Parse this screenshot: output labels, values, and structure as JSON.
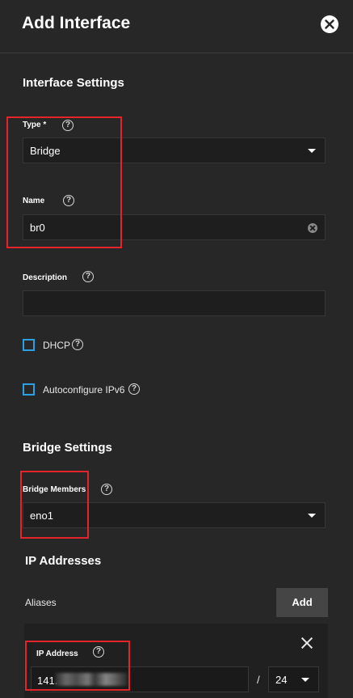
{
  "dialog": {
    "title": "Add Interface"
  },
  "interface_settings": {
    "heading": "Interface Settings",
    "type": {
      "label": "Type *",
      "value": "Bridge"
    },
    "name": {
      "label": "Name",
      "value": "br0"
    },
    "description": {
      "label": "Description",
      "value": ""
    },
    "dhcp": {
      "label": "DHCP",
      "checked": false
    },
    "autoconfigure_ipv6": {
      "label": "Autoconfigure IPv6",
      "checked": false
    }
  },
  "bridge_settings": {
    "heading": "Bridge Settings",
    "bridge_members": {
      "label": "Bridge Members",
      "value": "eno1"
    }
  },
  "ip_addresses": {
    "heading": "IP Addresses",
    "aliases_label": "Aliases",
    "add_label": "Add",
    "entries": [
      {
        "label": "IP Address",
        "value": "141.",
        "separator": "/",
        "netmask": "24"
      }
    ]
  },
  "icons": {
    "close": "close-circle-icon",
    "help": "help-circle-icon",
    "caret": "caret-down-icon",
    "clear": "clear-circle-icon",
    "remove": "close-icon"
  },
  "colors": {
    "background": "#272727",
    "field_bg": "#1e1e1e",
    "checkbox_border": "#2da0e0",
    "highlight": "#e3242b",
    "button_bg": "#454545"
  }
}
